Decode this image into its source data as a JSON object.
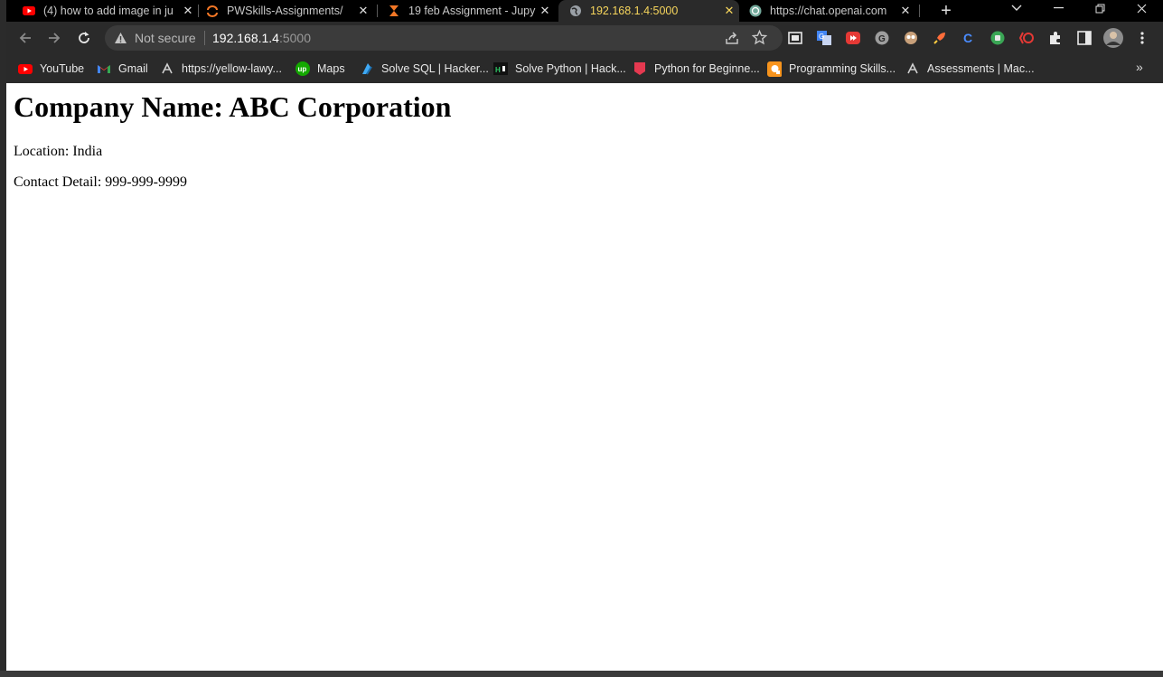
{
  "browser": {
    "tabs": [
      {
        "title": "(4) how to add image in ju",
        "icon": "youtube-icon",
        "active": false
      },
      {
        "title": "PWSkills-Assignments/",
        "icon": "jupyter-icon",
        "active": false
      },
      {
        "title": "19 feb Assignment - Jupy",
        "icon": "hourglass-icon",
        "active": false
      },
      {
        "title": "192.168.1.4:5000",
        "icon": "globe-icon",
        "active": true
      },
      {
        "title": "https://chat.openai.com",
        "icon": "openai-icon",
        "active": false
      }
    ],
    "omnibox": {
      "security_label": "Not secure",
      "host": "192.168.1.4",
      "port": ":5000"
    },
    "bookmarks": [
      {
        "label": "YouTube",
        "icon": "youtube-icon"
      },
      {
        "label": "Gmail",
        "icon": "gmail-icon"
      },
      {
        "label": "https://yellow-lawy...",
        "icon": "link-icon"
      },
      {
        "label": "Maps",
        "icon": "upwork-icon"
      },
      {
        "label": "Solve SQL | Hacker...",
        "icon": "hackerrank-icon"
      },
      {
        "label": "Solve Python | Hack...",
        "icon": "hackerrank-icon"
      },
      {
        "label": "Python for Beginne...",
        "icon": "bookmark-icon"
      },
      {
        "label": "Programming Skills...",
        "icon": "orange-icon"
      },
      {
        "label": "Assessments | Mac...",
        "icon": "link-icon"
      }
    ],
    "colors": {
      "active_tab_text": "#f6d55c",
      "chrome_bg": "#2a2a2a",
      "tabstrip_bg": "#000000"
    }
  },
  "page": {
    "heading": "Company Name: ABC Corporation",
    "location": "Location: India",
    "contact": "Contact Detail: 999-999-9999"
  }
}
